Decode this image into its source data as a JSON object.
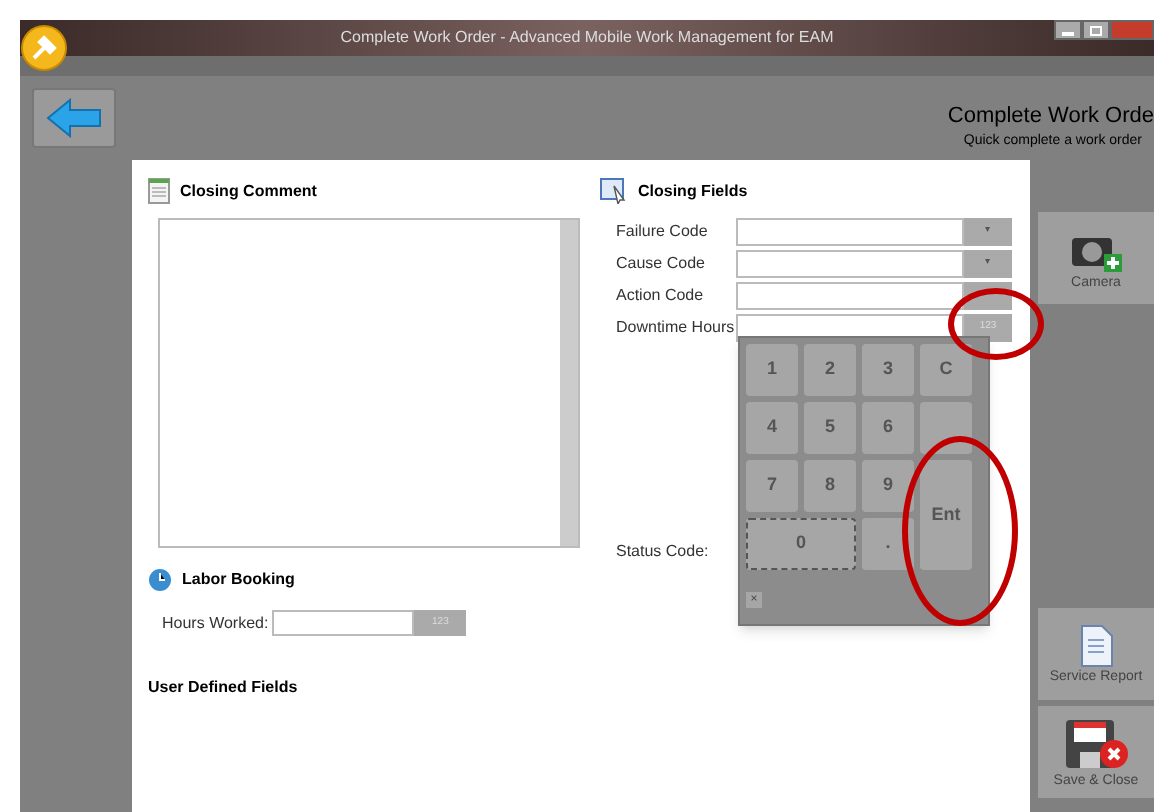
{
  "window": {
    "title": "Complete Work Order - Advanced Mobile Work Management for EAM"
  },
  "header": {
    "title": "Complete Work Orde",
    "subtitle": "Quick complete a work order"
  },
  "closing_comment": {
    "heading": "Closing Comment"
  },
  "closing_fields": {
    "heading": "Closing Fields",
    "fields": [
      {
        "label": "Failure Code",
        "kind": "dropdown",
        "button": "▾"
      },
      {
        "label": "Cause Code",
        "kind": "dropdown",
        "button": "▾"
      },
      {
        "label": "Action Code",
        "kind": "dropdown"
      },
      {
        "label": "Downtime Hours",
        "kind": "numeric",
        "button": "123"
      }
    ],
    "status_label": "Status Code:"
  },
  "keypad": {
    "keys": [
      {
        "label": "1",
        "kind": "key"
      },
      {
        "label": "2",
        "kind": "key"
      },
      {
        "label": "3",
        "kind": "key"
      },
      {
        "label": "C",
        "kind": "key"
      },
      {
        "label": "4",
        "kind": "key"
      },
      {
        "label": "5",
        "kind": "key"
      },
      {
        "label": "6",
        "kind": "key"
      },
      {
        "kind": "blank"
      },
      {
        "label": "7",
        "kind": "key"
      },
      {
        "label": "8",
        "kind": "key"
      },
      {
        "label": "9",
        "kind": "key"
      },
      {
        "label": "Ent",
        "kind": "enter"
      },
      {
        "label": "0",
        "kind": "zero"
      },
      {
        "label": ".",
        "kind": "key"
      }
    ],
    "close": "×"
  },
  "labor_booking": {
    "heading": "Labor Booking",
    "label": "Hours Worked:",
    "button": "123"
  },
  "user_defined": {
    "heading": "User Defined Fields"
  },
  "sidebar": [
    {
      "label": "Camera",
      "kind": "camera"
    },
    {
      "label": "Service Report",
      "kind": "report"
    },
    {
      "label": "Save & Close",
      "kind": "save"
    }
  ]
}
